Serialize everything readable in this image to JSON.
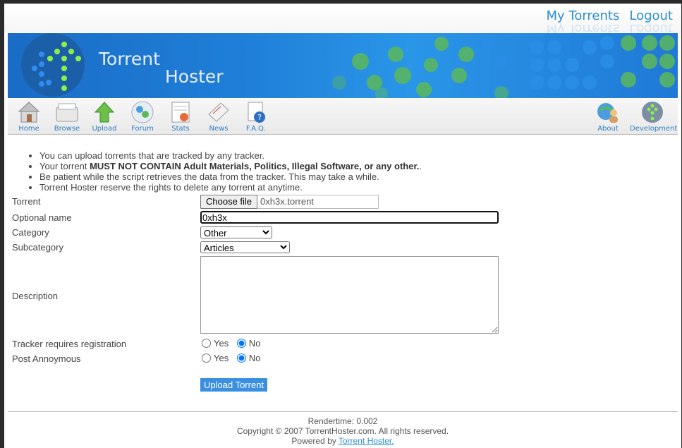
{
  "header": {
    "links": [
      {
        "label": "My Torrents"
      },
      {
        "label": "Logout"
      }
    ]
  },
  "banner": {
    "title_line1": "Torrent",
    "title_line2": "Hoster"
  },
  "nav": {
    "left": [
      {
        "label": "Home",
        "icon": "home-icon"
      },
      {
        "label": "Browse",
        "icon": "browse-icon"
      },
      {
        "label": "Upload",
        "icon": "upload-icon"
      },
      {
        "label": "Forum",
        "icon": "forum-icon"
      },
      {
        "label": "Stats",
        "icon": "stats-icon"
      },
      {
        "label": "News",
        "icon": "news-icon"
      },
      {
        "label": "F.A.Q.",
        "icon": "faq-icon"
      }
    ],
    "right": [
      {
        "label": "About",
        "icon": "about-icon"
      },
      {
        "label": "Development",
        "icon": "development-icon"
      }
    ]
  },
  "notes": [
    {
      "text": "You can upload torrents that are tracked by any tracker."
    },
    {
      "prefix": "Your torrent ",
      "bold": "MUST NOT CONTAIN Adult Materials, Politics, Illegal Software, or any other.",
      "suffix": "."
    },
    {
      "text": "Be patient while the script retrieves the data from the tracker. This may take a while."
    },
    {
      "text": "Torrent Hoster reserve the rights to delete any torrent at anytime."
    }
  ],
  "form": {
    "torrent": {
      "label": "Torrent",
      "button": "Choose file",
      "filename": "0xh3x.torrent"
    },
    "optional_name": {
      "label": "Optional name",
      "value": "0xh3x"
    },
    "category": {
      "label": "Category",
      "selected": "Other"
    },
    "subcategory": {
      "label": "Subcategory",
      "selected": "Articles"
    },
    "description": {
      "label": "Description",
      "value": ""
    },
    "tracker_registration": {
      "label": "Tracker requires registration",
      "yes": "Yes",
      "no": "No",
      "selected": "No"
    },
    "post_anonymous": {
      "label": "Post Annoymous",
      "yes": "Yes",
      "no": "No",
      "selected": "No"
    },
    "submit_label": "Upload Torrent"
  },
  "footer": {
    "rendertime": "Rendertime: 0.002",
    "copyright": "Copyright © 2007 TorrentHoster.com. All rights reserved.",
    "powered_prefix": "Powered by ",
    "powered_link": "Torrent Hoster."
  },
  "colors": {
    "accent": "#2e8fd0",
    "banner": "#1f7fd8",
    "button": "#3a8fe0",
    "dots": "#4caf50"
  }
}
